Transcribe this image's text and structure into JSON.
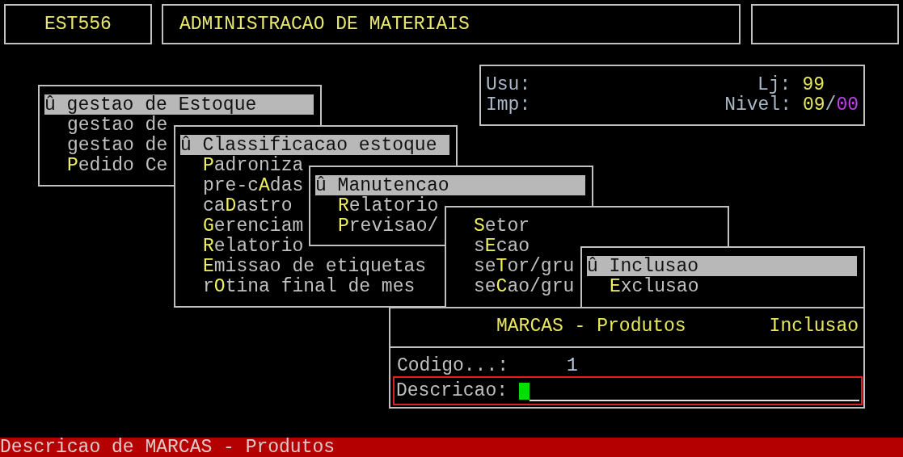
{
  "program_code": "EST556",
  "title": "ADMINISTRACAO DE MATERIAIS",
  "info": {
    "usu_label": "Usu:",
    "imp_label": "Imp:",
    "lj_label": "Lj:",
    "lj_value": "99",
    "nivel_label": "Nivel:",
    "nivel_values": [
      {
        "text": "09",
        "color": "#e8e860"
      },
      {
        "text": "/",
        "color": "#a8b8c8"
      },
      {
        "text": "00",
        "color": "#c040f0"
      }
    ]
  },
  "menus": [
    {
      "items": [
        {
          "selected": true,
          "segments": [
            {
              "text": "û gestao de Estoque"
            }
          ]
        },
        {
          "selected": false,
          "segments": [
            {
              "text": "gestao de",
              "hotkey": false
            }
          ]
        },
        {
          "selected": false,
          "segments": [
            {
              "text": "gestao de",
              "hotkey": false
            }
          ]
        },
        {
          "selected": false,
          "segments": [
            {
              "text": "P",
              "hotkey": true
            },
            {
              "text": "edido Ce",
              "hotkey": false
            }
          ]
        }
      ]
    },
    {
      "items": [
        {
          "selected": true,
          "segments": [
            {
              "text": "û Classificacao estoque"
            }
          ]
        },
        {
          "selected": false,
          "segments": [
            {
              "text": "P",
              "hotkey": true
            },
            {
              "text": "adroniza",
              "hotkey": false
            }
          ]
        },
        {
          "selected": false,
          "segments": [
            {
              "text": "pre-c",
              "hotkey": false
            },
            {
              "text": "A",
              "hotkey": true
            },
            {
              "text": "das",
              "hotkey": false
            }
          ]
        },
        {
          "selected": false,
          "segments": [
            {
              "text": "ca",
              "hotkey": false
            },
            {
              "text": "D",
              "hotkey": true
            },
            {
              "text": "astro",
              "hotkey": false
            }
          ]
        },
        {
          "selected": false,
          "segments": [
            {
              "text": "G",
              "hotkey": true
            },
            {
              "text": "erenciam",
              "hotkey": false
            }
          ]
        },
        {
          "selected": false,
          "segments": [
            {
              "text": "R",
              "hotkey": true
            },
            {
              "text": "elatorio",
              "hotkey": false
            }
          ]
        },
        {
          "selected": false,
          "segments": [
            {
              "text": "E",
              "hotkey": true
            },
            {
              "text": "missao de etiquetas",
              "hotkey": false
            }
          ]
        },
        {
          "selected": false,
          "segments": [
            {
              "text": "r",
              "hotkey": false
            },
            {
              "text": "O",
              "hotkey": true
            },
            {
              "text": "tina final de mes",
              "hotkey": false
            }
          ]
        }
      ]
    },
    {
      "items": [
        {
          "selected": true,
          "segments": [
            {
              "text": "û Manutencao"
            }
          ]
        },
        {
          "selected": false,
          "segments": [
            {
              "text": "R",
              "hotkey": true
            },
            {
              "text": "elatorio",
              "hotkey": false
            }
          ]
        },
        {
          "selected": false,
          "segments": [
            {
              "text": "P",
              "hotkey": true
            },
            {
              "text": "revisao/",
              "hotkey": false
            }
          ]
        }
      ]
    },
    {
      "items": [
        {
          "selected": false,
          "segments": [
            {
              "text": "S",
              "hotkey": true
            },
            {
              "text": "etor",
              "hotkey": false
            }
          ]
        },
        {
          "selected": false,
          "segments": [
            {
              "text": "s",
              "hotkey": false
            },
            {
              "text": "E",
              "hotkey": true
            },
            {
              "text": "cao",
              "hotkey": false
            }
          ]
        },
        {
          "selected": false,
          "segments": [
            {
              "text": "se",
              "hotkey": false
            },
            {
              "text": "T",
              "hotkey": true
            },
            {
              "text": "or/gru",
              "hotkey": false
            }
          ]
        },
        {
          "selected": false,
          "segments": [
            {
              "text": "se",
              "hotkey": false
            },
            {
              "text": "C",
              "hotkey": true
            },
            {
              "text": "ao/gru",
              "hotkey": false
            }
          ]
        }
      ]
    },
    {
      "items": [
        {
          "selected": true,
          "segments": [
            {
              "text": "û Inclusao"
            }
          ]
        },
        {
          "selected": false,
          "segments": [
            {
              "text": "E",
              "hotkey": true
            },
            {
              "text": "xclusao",
              "hotkey": false
            }
          ]
        }
      ]
    }
  ],
  "form": {
    "title": "MARCAS - Produtos",
    "mode": "Inclusao",
    "codigo_label": "Codigo...:",
    "codigo_value": "1",
    "descricao_label": "Descricao:"
  },
  "status_bar": "Descricao de MARCAS - Produtos"
}
